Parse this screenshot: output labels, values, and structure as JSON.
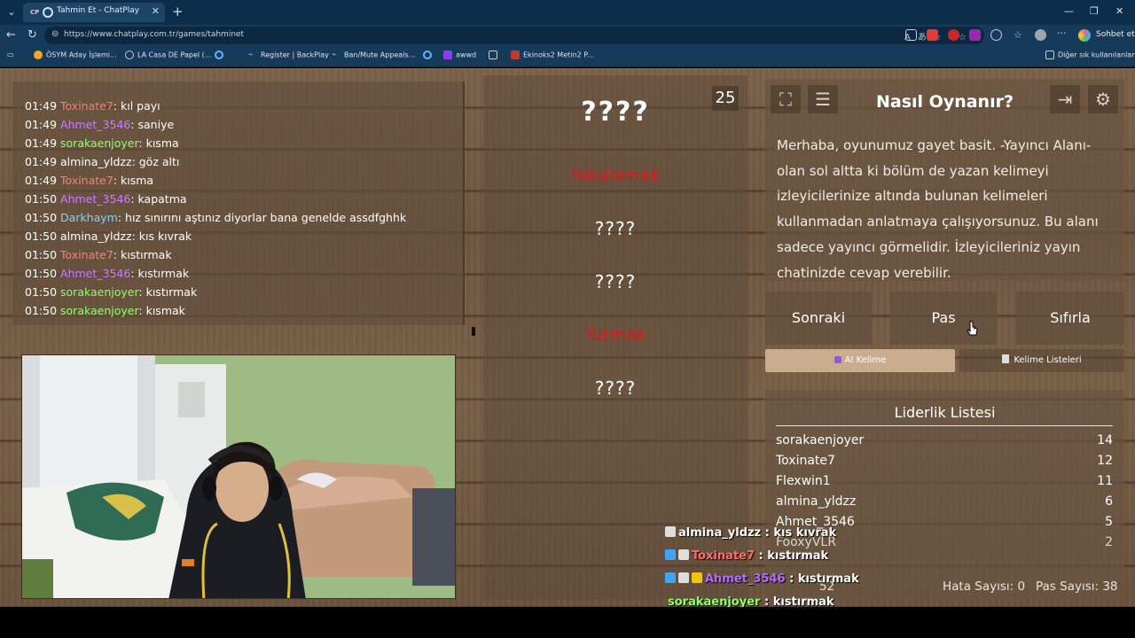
{
  "browser": {
    "tab_title": "Tahmin Et - ChatPlay",
    "tab_favicon": "CP",
    "url": "https://www.chatplay.com.tr/games/tahminet",
    "copilot_label": "Sohbet et",
    "bookmarks": [
      {
        "label": "ÖSYM Aday İşlemi...",
        "color": "#f5a623"
      },
      {
        "label": "LA Casa DE Papel (...",
        "color": "#cccccc"
      },
      {
        "label": "",
        "color": "#62b6ff"
      },
      {
        "label": "Register | BackPlay",
        "color": "#9ad"
      },
      {
        "label": "Ban/Mute Appeals...",
        "color": "#9ad"
      },
      {
        "label": "",
        "color": "#62b6ff"
      },
      {
        "label": "awwd",
        "color": "#8a3cf0"
      },
      {
        "label": "",
        "color": "#ccc"
      },
      {
        "label": "Ekinoks2 Metin2 P...",
        "color": "#c0392b"
      }
    ],
    "other_bookmarks": "Diğer sık kullanılanlar"
  },
  "chat": {
    "lines": [
      {
        "time": "01:49",
        "user": "Toxinate7",
        "color": "#ff7a7a",
        "msg": ": kıl payı"
      },
      {
        "time": "01:49",
        "user": "Ahmet_3546",
        "color": "#c77dff",
        "msg": ": saniye"
      },
      {
        "time": "01:49",
        "user": "sorakaenjoyer",
        "color": "#8dff6a",
        "msg": ": kısma"
      },
      {
        "time": "01:49",
        "user": "almina_yldzz",
        "color": "#ffffff",
        "msg": ": göz altı"
      },
      {
        "time": "01:49",
        "user": "Toxinate7",
        "color": "#ff7a7a",
        "msg": ": kısma"
      },
      {
        "time": "01:50",
        "user": "Ahmet_3546",
        "color": "#c77dff",
        "msg": ": kapatma"
      },
      {
        "time": "01:50",
        "user": "Darkhaym",
        "color": "#7fd4ff",
        "msg": ": hız sınırını aştınız diyorlar bana genelde assdfghhk"
      },
      {
        "time": "01:50",
        "user": "almina_yldzz",
        "color": "#ffffff",
        "msg": ": kıs kıvrak"
      },
      {
        "time": "01:50",
        "user": "Toxinate7",
        "color": "#ff7a7a",
        "msg": ": kıstırmak"
      },
      {
        "time": "01:50",
        "user": "Ahmet_3546",
        "color": "#c77dff",
        "msg": ": kıstırmak"
      },
      {
        "time": "01:50",
        "user": "sorakaenjoyer",
        "color": "#8dff6a",
        "msg": ": kıstırmak"
      },
      {
        "time": "01:50",
        "user": "sorakaenjoyer",
        "color": "#8dff6a",
        "msg": ": kısmak"
      }
    ]
  },
  "game": {
    "timer": "25",
    "words": [
      {
        "text": "????",
        "style": "big"
      },
      {
        "text": "Yakalamak",
        "style": "red"
      },
      {
        "text": "????",
        "style": "q"
      },
      {
        "text": "????",
        "style": "q"
      },
      {
        "text": "Tutmak",
        "style": "red"
      },
      {
        "text": "????",
        "style": "q"
      }
    ]
  },
  "howto": {
    "title": "Nasıl Oynanır?",
    "body": "Merhaba, oyunumuz gayet basit. -Yayıncı Alanı- olan sol altta ki bölüm de yazan kelimeyi izleyicilerinize altında bulunan kelimeleri kullanmadan anlatmaya çalışıyorsunuz. Bu alanı sadece yayıncı görmelidir. İzleyicileriniz yayın chatinizde cevap verebilir.",
    "icons": [
      "expand-icon",
      "document-icon",
      "exit-icon",
      "gear-icon"
    ]
  },
  "actions": {
    "next": "Sonraki",
    "pass": "Pas",
    "reset": "Sıfırla",
    "tab_ai": "AI Kelime",
    "tab_lists": "Kelime Listeleri"
  },
  "leaderboard": {
    "title": "Liderlik Listesi",
    "rows": [
      {
        "name": "sorakaenjoyer",
        "score": "14"
      },
      {
        "name": "Toxinate7",
        "score": "12"
      },
      {
        "name": "Flexwin1",
        "score": "11"
      },
      {
        "name": "almina_yldzz",
        "score": "6"
      },
      {
        "name": "Ahmet_3546",
        "score": "5"
      },
      {
        "name": "FooxyVLR",
        "score": "2"
      }
    ],
    "total_label": "52",
    "errors_label": "Hata Sayısı: 0",
    "passes_label": "Pas Sayısı: 38"
  },
  "overlay_chat": [
    {
      "user": "almina_yldzz",
      "color": "#ffffff",
      "msg": " : kıs kıvrak",
      "badges": [
        "#ddd"
      ]
    },
    {
      "user": "Toxinate7",
      "color": "#ff6b6b",
      "msg": " : kıstırmak",
      "badges": [
        "#3da5ff",
        "#ddd"
      ]
    },
    {
      "user": "Ahmet_3546",
      "color": "#b36bff",
      "msg": " : kıstırmak",
      "badges": [
        "#3da5ff",
        "#ddd",
        "#f1c40f"
      ]
    },
    {
      "user": "sorakaenjoyer",
      "color": "#8dff6a",
      "msg": " : kıstırmak",
      "badges": []
    },
    {
      "user": "sorakaenjoyer",
      "color": "#8dff6a",
      "msg": " : kısmak",
      "badges": []
    }
  ]
}
